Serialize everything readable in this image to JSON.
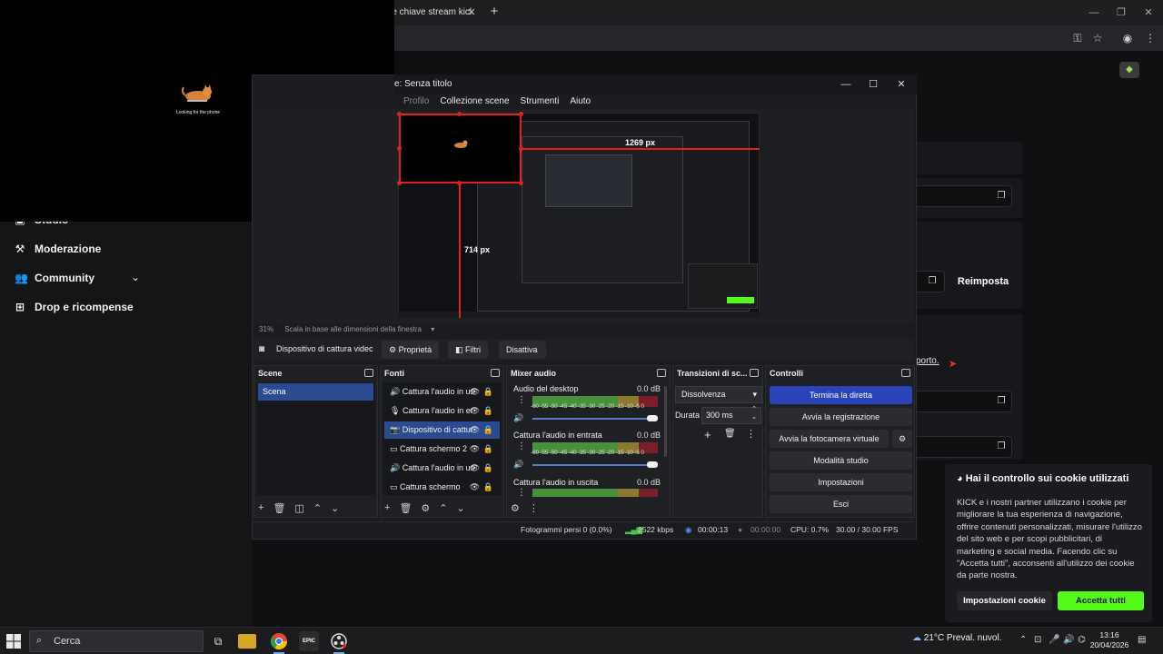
{
  "chrome": {
    "tab_title": "re chiave stream kick",
    "tab_close": "✕",
    "new_tab": "+",
    "minimize": "—",
    "restore": "❐",
    "close": "✕"
  },
  "preview": {
    "caption": "Looking for the phone"
  },
  "sidebar": {
    "items": [
      {
        "label": "Studio",
        "icon": "studio-icon"
      },
      {
        "label": "Moderazione",
        "icon": "hammer-icon"
      },
      {
        "label": "Community",
        "icon": "users-icon"
      },
      {
        "label": "Drop e ricompense",
        "icon": "gift-icon"
      }
    ]
  },
  "settings": {
    "reset_label": "Reimposta",
    "support_text": "porto",
    "support_suffix": "."
  },
  "obs": {
    "title": "e: Senza titolo",
    "menu": [
      "Profilo",
      "Collezione scene",
      "Strumenti",
      "Aiuto"
    ],
    "canvas": {
      "width_label": "1269 px",
      "height_label": "714 px"
    },
    "zoom": {
      "percent": "31%",
      "mode": "Scala in base alle dimensioni della finestra"
    },
    "source_toolbar": {
      "selected_source": "Dispositivo di cattura videc",
      "properties": "Proprietà",
      "filters": "Filtri",
      "deactivate": "Disattiva"
    },
    "docks": {
      "scenes": {
        "title": "Scene",
        "items": [
          "Scena"
        ]
      },
      "sources": {
        "title": "Fonti",
        "items": [
          {
            "label": "Cattura l'audio in us",
            "icon": "speaker-icon"
          },
          {
            "label": "Cattura l'audio in er",
            "icon": "mic-icon"
          },
          {
            "label": "Dispositivo di cattur",
            "icon": "camera-icon",
            "selected": true
          },
          {
            "label": "Cattura schermo 2",
            "icon": "monitor-icon"
          },
          {
            "label": "Cattura l'audio in us",
            "icon": "speaker-icon"
          },
          {
            "label": "Cattura schermo",
            "icon": "monitor-icon"
          }
        ]
      },
      "mixer": {
        "title": "Mixer audio",
        "scale": "-60 -55 -50 -45 -40 -35 -30 -25 -20 -15 -10 -5 0",
        "channels": [
          {
            "name": "Audio del desktop",
            "db": "0.0 dB",
            "volume": 1.0
          },
          {
            "name": "Cattura l'audio in entrata",
            "db": "0.0 dB",
            "volume": 1.0
          },
          {
            "name": "Cattura l'audio in uscita",
            "db": "0.0 dB",
            "volume": 1.0
          }
        ]
      },
      "transitions": {
        "title": "Transizioni di sc...",
        "selected": "Dissolvenza",
        "duration_label": "Durata",
        "duration_value": "300 ms"
      },
      "controls": {
        "title": "Controlli",
        "buttons": [
          "Termina la diretta",
          "Avvia la registrazione",
          "Avvia la fotocamera virtuale",
          "Modalità studio",
          "Impostazioni",
          "Esci"
        ]
      }
    },
    "status": {
      "dropped_frames": "Fotogrammi persi 0 (0.0%)",
      "bitrate": "2522 kbps",
      "live_time": "00:00:13",
      "rec_time": "00:00:00",
      "cpu": "CPU: 0.7%",
      "fps": "30.00 / 30.00 FPS"
    }
  },
  "cookie": {
    "title": "Hai il controllo sui cookie utilizzati",
    "body": "KICK e i nostri partner utilizzano i cookie per migliorare la tua esperienza di navigazione, offrire contenuti personalizzati, misurare l'utilizzo del sito web e per scopi pubblicitari, di marketing e social media. Facendo clic su \"Accetta tutti\", acconsenti all'utilizzo dei cookie da parte nostra.",
    "settings_button": "Impostazioni cookie",
    "accept_button": "Accetta tutti"
  },
  "taskbar": {
    "search_placeholder": "Cerca",
    "apps": [
      "task-view-icon",
      "file-explorer-icon",
      "chrome-icon",
      "epic-games-icon",
      "obs-icon"
    ],
    "epic_label": "EPIC",
    "weather": "21°C  Preval. nuvol.",
    "time": "13:16",
    "date": "20/04/2026"
  },
  "colors": {
    "kick_green": "#53fc18",
    "obs_accent": "#2844b8",
    "selection_red": "#e02020"
  }
}
